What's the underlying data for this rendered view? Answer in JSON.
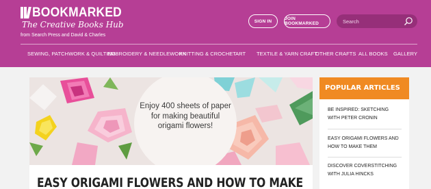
{
  "brand": {
    "name": "BOOKMARKED",
    "tagline": "The Creative Books Hub",
    "byline": "from Search Press and David & Charles"
  },
  "header": {
    "sign_in": "SIGN IN",
    "join": "JOIN BOOKMARKED",
    "search_placeholder": "Search"
  },
  "nav": {
    "items": [
      "SEWING, PATCHWORK & QUILTING",
      "EMBROIDERY & NEEDLEWORK",
      "KNITTING & CROCHET",
      "ART",
      "TEXTILE & YARN CRAFT",
      "OTHER CRAFTS",
      "ALL BOOKS",
      "GALLERY"
    ]
  },
  "hero": {
    "text": "Enjoy 400 sheets of paper for making beautiful origami flowers!"
  },
  "article": {
    "title": "EASY ORIGAMI FLOWERS AND HOW TO MAKE"
  },
  "sidebar": {
    "heading": "POPULAR ARTICLES",
    "items": [
      "BE INSPIRED: SKETCHING WITH PETER CRONIN",
      "EASY ORIGAMI FLOWERS AND HOW TO MAKE THEM",
      "DISCOVER COVERSTITCHING WITH JULIA HINCKS"
    ]
  },
  "colors": {
    "header": "#b63e95",
    "accent": "#f08a22"
  }
}
